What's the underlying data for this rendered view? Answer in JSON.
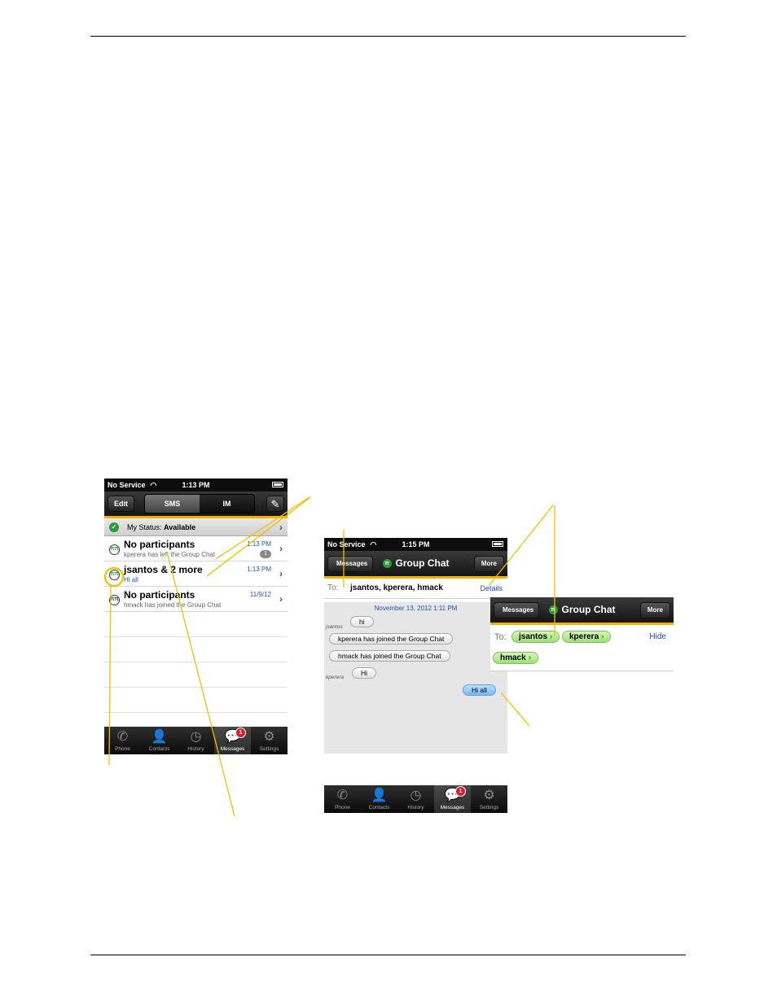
{
  "phone1": {
    "statusbar": {
      "carrier": "No Service",
      "time": "1:13 PM"
    },
    "toolbar": {
      "edit": "Edit",
      "sms": "SMS",
      "im": "IM"
    },
    "my_status": {
      "label": "My Status:",
      "value": "Available"
    },
    "conversations": [
      {
        "title": "No participants",
        "subtitle": "kperera has left the Group Chat",
        "time": "1:13 PM",
        "badge": "1"
      },
      {
        "title": "jsantos & 2 more",
        "subtitle": "Hi all",
        "time": "1:13 PM"
      },
      {
        "title": "No participants",
        "subtitle": "hmack has joined the Group Chat",
        "time": "11/9/12"
      }
    ],
    "tabs": [
      {
        "label": "Phone",
        "icon": "phone-icon"
      },
      {
        "label": "Contacts",
        "icon": "contacts-icon"
      },
      {
        "label": "History",
        "icon": "history-icon"
      },
      {
        "label": "Messages",
        "icon": "messages-icon",
        "badge": "1"
      },
      {
        "label": "Settings",
        "icon": "settings-icon"
      }
    ]
  },
  "phone2": {
    "statusbar": {
      "carrier": "No Service",
      "time": "1:15 PM"
    },
    "navbar": {
      "back": "Messages",
      "title": "Group Chat",
      "more": "More"
    },
    "to_row": {
      "label": "To:",
      "names": "jsantos, kperera, hmack",
      "details": "Details"
    },
    "chat": {
      "date": "November 13, 2012 1:11 PM",
      "messages": [
        {
          "sender": "jsantos",
          "text": "hi"
        },
        {
          "sender": "",
          "text": "kperera has joined the Group Chat"
        },
        {
          "sender": "",
          "text": "hmack has joined the Group Chat"
        },
        {
          "sender": "kperera",
          "text": "Hi"
        },
        {
          "sender": "",
          "text": "Hi all"
        }
      ]
    },
    "tabs": [
      {
        "label": "Phone"
      },
      {
        "label": "Contacts"
      },
      {
        "label": "History"
      },
      {
        "label": "Messages",
        "badge": "1"
      },
      {
        "label": "Settings"
      }
    ]
  },
  "inset": {
    "navbar": {
      "back": "Messages",
      "title": "Group Chat",
      "more": "More"
    },
    "to_label": "To:",
    "recipients": [
      "jsantos",
      "kperera",
      "hmack"
    ],
    "hide": "Hide"
  },
  "colors": {
    "accent_gold": "#f0b400",
    "link_blue": "#2244bb",
    "available_green": "#2a9c3a",
    "badge_red": "#d8202a"
  }
}
